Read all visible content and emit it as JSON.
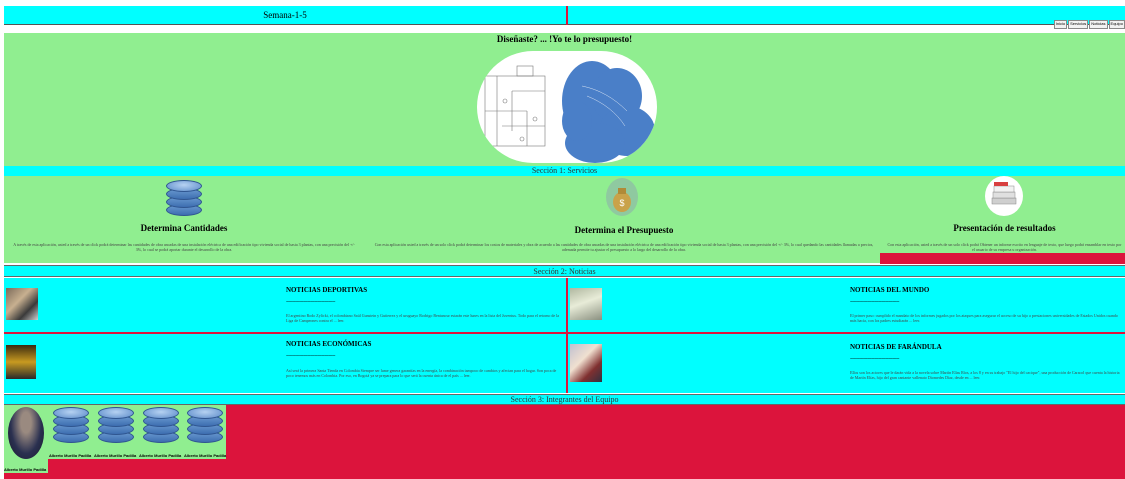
{
  "header": {
    "title": "Semana-1-5",
    "nav": [
      "Inicio",
      "Servicios",
      "Noticias",
      "Equipo"
    ]
  },
  "hero": {
    "title": "Diseñaste? ... !Yo te lo presupuesto!"
  },
  "section1": {
    "title": "Sección 1: Servicios",
    "services": [
      {
        "icon": "database-icon",
        "title": "Determina Cantidades",
        "text": "A través de esta aplicación, usted a través de un click podrá determinar las cantidades de obra ancadas de una instalación eléctrica de una edificación tipo vivienda social de hasta 3 plantas, con una precisión del +/- 3%, lo cual se podrá aportar durante el desarrollo de la obra."
      },
      {
        "icon": "money-bag-icon",
        "title": "Determina el Presupuesto",
        "text": "Con esta aplicación usted a través de un solo click podrá determinar los costos de materiales y obra de acuerdo a las cantidades de obra ancadas de una instalación eléctrica de una edificación tipo vivienda social de hasta 3 plantas, con una precisión del +/- 3%, lo cual quedando las cantidades llamadas a precios, ademada permite tu ajustar el presupuesto a lo largo del desarrollo de la obra."
      },
      {
        "icon": "document-stack-icon",
        "title": "Presentación de resultados",
        "text": "Con esta aplicación, usted a través de un solo click podrá Obtener un informe escrito en lenguaje de texto, que luego podrá ensamblar en texto por el usuario de su empresa u organización."
      }
    ]
  },
  "section2": {
    "title": "Sección 2: Noticias",
    "dashes": "------------------------------------------",
    "news": [
      {
        "title": "NOTICIAS DEPORTIVAS",
        "text": "El argentino Rodo Zylicki, el colombiano Saúl Gunstein y Gutierrez y el uruguayo Rodrigo Bentancur estarán este lunes en la lista del Juventus. Todo para el retorno de la Liga de Campeones contra el ... leer."
      },
      {
        "title": "NOTICIAS DEL MUNDO",
        "text": "El primer paso: cumplido el mandato de los informes jugados por los ataques para asegurar el acceso de su hijo a prestaciones universidades de Estados Unidos cuando más hacía, con los padres estudiarán ... leer."
      },
      {
        "title": "NOTICIAS ECONÓMICAS",
        "text": "Así será la primera Santa Tienda en Colombia Siempre ser lume genera garantías en la energía, la combinación tampoco de cambios y afectan para el hogar. Son poca de poco tenemos más en Colombia. Por eso, en Bogotá ya se prepara para lo que será la cuenta única de el país ... leer."
      },
      {
        "title": "NOTICIAS DE FARÁNDULA",
        "text": "Ellos son los actores que le darán vida a la novela sobre Martín Elías Ríos, a los 8 y en su trabajo \"El hijo del cacique\", una producción de Caracol que cuenta la historia de Martín Elías, hijo del gran cantante vallenato Diomedes Díaz, desde en ... leer."
      }
    ]
  },
  "section3": {
    "title": "Sección 3: Integrantes del Equipo",
    "members": [
      {
        "name": "Alberto Murillo Padilla",
        "avatar": "person-photo"
      },
      {
        "name": "Alberto Murillo Padilla",
        "avatar": "database-icon"
      },
      {
        "name": "Alberto Murillo Padilla",
        "avatar": "database-icon"
      },
      {
        "name": "Alberto Murillo Padilla",
        "avatar": "database-icon"
      },
      {
        "name": "Alberto Murillo Padilla",
        "avatar": "database-icon"
      }
    ]
  },
  "colors": {
    "cyan": "#00ffff",
    "green": "#90ee90",
    "crimson": "#dc143c",
    "blue": "#4a7fc8"
  }
}
